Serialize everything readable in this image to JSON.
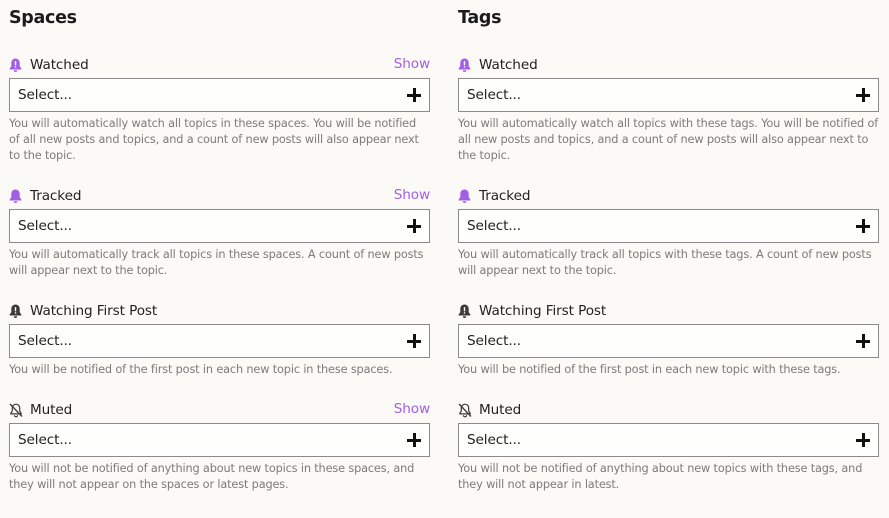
{
  "colors": {
    "accent": "#a45ee5",
    "background": "#fbfaf6",
    "help_text": "#7b7b7b"
  },
  "spaces": {
    "title": "Spaces",
    "groups": [
      {
        "icon": "watching-bell-icon",
        "label": "Watched",
        "show": "Show",
        "select": "Select...",
        "help": "You will automatically watch all topics in these spaces. You will be notified of all new posts and topics, and a count of new posts will also appear next to the topic."
      },
      {
        "icon": "tracking-bell-icon",
        "label": "Tracked",
        "show": "Show",
        "select": "Select...",
        "help": "You will automatically track all topics in these spaces. A count of new posts will appear next to the topic."
      },
      {
        "icon": "watching-first-post-bell-icon",
        "label": "Watching First Post",
        "select": "Select...",
        "help": "You will be notified of the first post in each new topic in these spaces."
      },
      {
        "icon": "muted-bell-slash-icon",
        "label": "Muted",
        "show": "Show",
        "select": "Select...",
        "help": "You will not be notified of anything about new topics in these spaces, and they will not appear on the spaces or latest pages."
      }
    ]
  },
  "tags": {
    "title": "Tags",
    "groups": [
      {
        "icon": "watching-bell-icon",
        "label": "Watched",
        "select": "Select...",
        "help": "You will automatically watch all topics with these tags. You will be notified of all new posts and topics, and a count of new posts will also appear next to the topic."
      },
      {
        "icon": "tracking-bell-icon",
        "label": "Tracked",
        "select": "Select...",
        "help": "You will automatically track all topics with these tags. A count of new posts will appear next to the topic."
      },
      {
        "icon": "watching-first-post-bell-icon",
        "label": "Watching First Post",
        "select": "Select...",
        "help": "You will be notified of the first post in each new topic with these tags."
      },
      {
        "icon": "muted-bell-slash-icon",
        "label": "Muted",
        "select": "Select...",
        "help": "You will not be notified of anything about new topics with these tags, and they will not appear in latest."
      }
    ]
  }
}
